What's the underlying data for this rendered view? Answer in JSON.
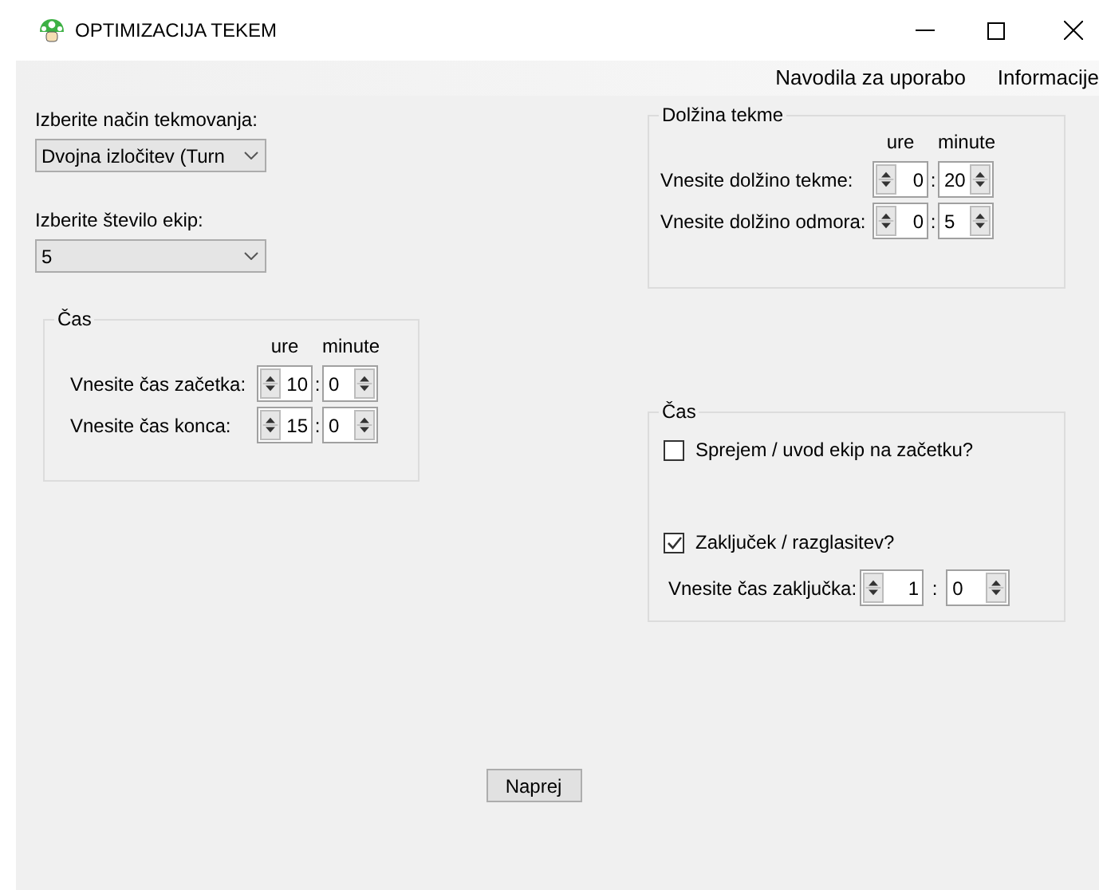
{
  "window": {
    "title": "OPTIMIZACIJA TEKEM"
  },
  "menu": [
    {
      "label": "Navodila za uporabo"
    },
    {
      "label": "Informacije"
    }
  ],
  "mode": {
    "label": "Izberite način tekmovanja:",
    "value": "Dvojna izločitev (Turn"
  },
  "teams": {
    "label": "Izberite število ekip:",
    "value": "5"
  },
  "time_group": {
    "title": "Čas",
    "hour_header": "ure",
    "minute_header": "minute",
    "rows": [
      {
        "label": "Vnesite čas začetka:",
        "hours": "10",
        "separator": ":",
        "minutes": "0"
      },
      {
        "label": "Vnesite čas konca:",
        "hours": "15",
        "separator": ":",
        "minutes": "0"
      }
    ]
  },
  "length_group": {
    "title": "Dolžina tekme",
    "hour_header": "ure",
    "minute_header": "minute",
    "rows": [
      {
        "label": "Vnesite dolžino tekme:",
        "hours": "0",
        "separator": ":",
        "minutes": "20"
      },
      {
        "label": "Vnesite dolžino odmora:",
        "hours": "0",
        "separator": ":",
        "minutes": "5"
      }
    ]
  },
  "ceremony_group": {
    "title": "Čas",
    "options": [
      {
        "label": "Sprejem / uvod ekip na začetku?",
        "checked": false
      },
      {
        "label": "Zaključek / razglasitev?",
        "checked": true
      }
    ],
    "end_time": {
      "label": "Vnesite čas zaključka:",
      "hours": "1",
      "separator": ":",
      "minutes": "0"
    }
  },
  "next_button": "Naprej"
}
